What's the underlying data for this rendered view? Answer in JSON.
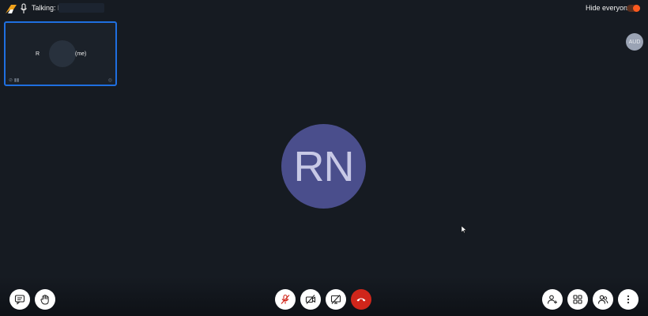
{
  "topbar": {
    "talking_label": "Talking: R",
    "hide_everyone_label": "Hide everyone",
    "hide_everyone_on": true,
    "toggle_color": "#ff5a1f"
  },
  "self_tile": {
    "initial": "R",
    "me_label": "(me)",
    "border_color": "#1f6fe0"
  },
  "audio_badge": {
    "label": "AUD"
  },
  "speaker": {
    "initials": "RN",
    "avatar_color": "#4a4e8c"
  },
  "toolbar": {
    "left": [
      "chat-icon",
      "raise-hand-icon"
    ],
    "center": [
      "mic-off-icon",
      "camera-off-icon",
      "screen-share-off-icon",
      "hangup-icon"
    ],
    "right": [
      "invite-icon",
      "tile-view-icon",
      "participants-icon",
      "more-options-icon"
    ],
    "hangup_color": "#d0261b"
  }
}
